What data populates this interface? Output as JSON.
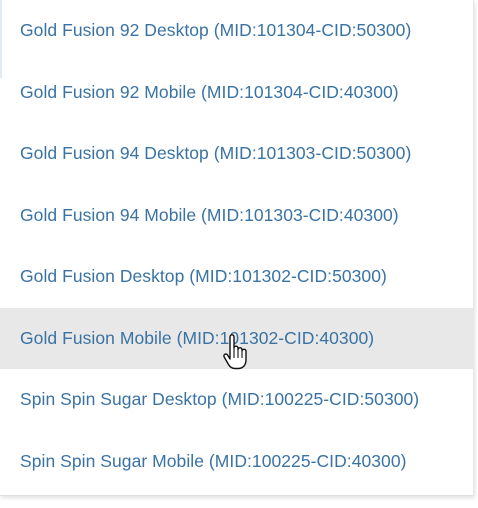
{
  "dropdown": {
    "options": [
      {
        "label": "Gold Fusion 92 Desktop (MID:101304-CID:50300)"
      },
      {
        "label": "Gold Fusion 92 Mobile (MID:101304-CID:40300)"
      },
      {
        "label": "Gold Fusion 94 Desktop (MID:101303-CID:50300)"
      },
      {
        "label": "Gold Fusion 94 Mobile (MID:101303-CID:40300)"
      },
      {
        "label": "Gold Fusion Desktop (MID:101302-CID:50300)"
      },
      {
        "label": "Gold Fusion Mobile (MID:101302-CID:40300)"
      },
      {
        "label": "Spin Spin Sugar Desktop (MID:100225-CID:50300)"
      },
      {
        "label": "Spin Spin Sugar Mobile (MID:100225-CID:40300)"
      }
    ],
    "hovered_index": 5
  },
  "colors": {
    "option_text": "#3a73a3",
    "hover_background": "#e8e8e8"
  },
  "icons": {
    "cursor": "hand-pointer-cursor-icon"
  }
}
